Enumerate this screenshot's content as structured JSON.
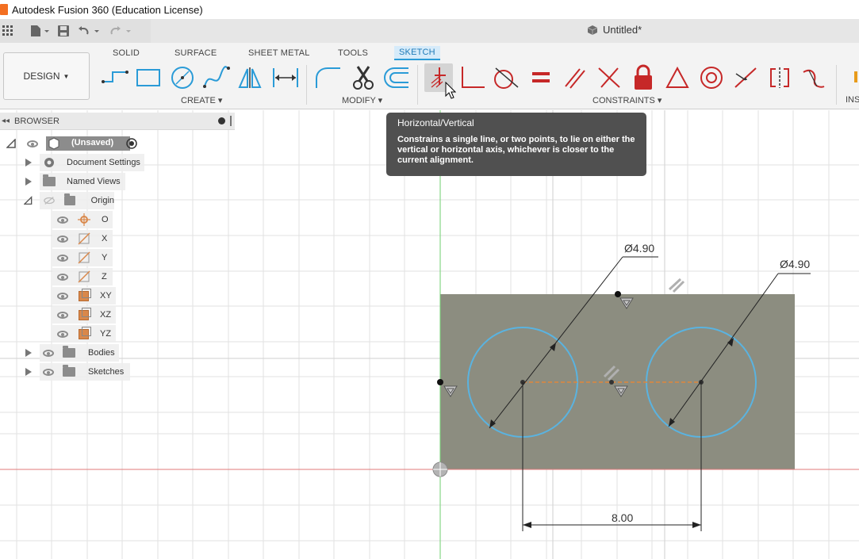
{
  "window": {
    "title": "Autodesk Fusion 360 (Education License)"
  },
  "document": {
    "name": "Untitled*"
  },
  "ribbon": {
    "workspace": "DESIGN",
    "tabs": [
      {
        "label": "SOLID",
        "active": false
      },
      {
        "label": "SURFACE",
        "active": false
      },
      {
        "label": "SHEET METAL",
        "active": false
      },
      {
        "label": "TOOLS",
        "active": false
      },
      {
        "label": "SKETCH",
        "active": true
      }
    ],
    "groups": {
      "create": "CREATE",
      "modify": "MODIFY",
      "constraints": "CONSTRAINTS",
      "inspect": "INS"
    }
  },
  "browser": {
    "title": "BROWSER",
    "root": "(Unsaved)",
    "items": [
      {
        "label": "Document Settings"
      },
      {
        "label": "Named Views"
      },
      {
        "label": "Origin"
      },
      {
        "label": "O"
      },
      {
        "label": "X"
      },
      {
        "label": "Y"
      },
      {
        "label": "Z"
      },
      {
        "label": "XY"
      },
      {
        "label": "XZ"
      },
      {
        "label": "YZ"
      },
      {
        "label": "Bodies"
      },
      {
        "label": "Sketches"
      }
    ]
  },
  "tooltip": {
    "title": "Horizontal/Vertical",
    "body": "Constrains a single line, or two points, to lie on either the vertical or horizontal axis, whichever is closer to the current alignment."
  },
  "sketch": {
    "dimensions": {
      "diameter_left": "Ø4.90",
      "diameter_right": "Ø4.90",
      "distance": "8.00"
    }
  },
  "colors": {
    "accent": "#2a9bd7",
    "constraint_red": "#c62828",
    "sketch_fill": "#8c8d80",
    "circle": "#5ab3e0"
  }
}
